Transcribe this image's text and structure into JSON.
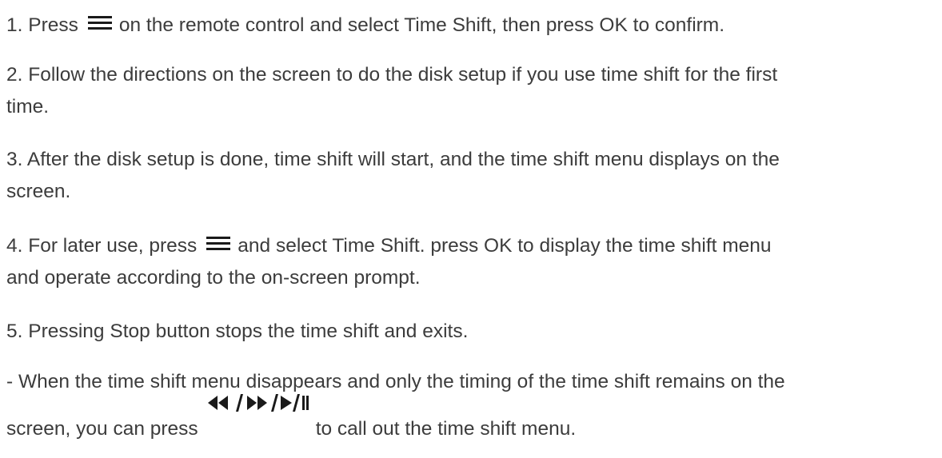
{
  "steps": [
    {
      "line1": "1. Press",
      "line1_after_icon": "on the remote control and select Time Shift, then press OK to confirm."
    },
    {
      "line1": "2. Follow the directions on the screen to do the disk setup if you use time shift for the first",
      "line2": "time."
    },
    {
      "line1": "3. After the disk setup is done, time shift will start, and the time shift menu displays on the",
      "line2": "screen."
    },
    {
      "line1": "4. For later use, press",
      "line1_after_icon": "and select Time Shift. press OK to display the time shift menu",
      "line2": "and operate according to the on-screen prompt."
    },
    {
      "line1": "5. Pressing Stop button stops the time shift and exits."
    }
  ],
  "note": {
    "line1": "- When the time shift menu disappears and only the timing of the time shift remains on the",
    "line2_before_icon": "screen, you can press",
    "line2_after_icon": "to call out the time shift menu."
  },
  "icons": {
    "menu": "menu-icon",
    "transport": "rewind-forward-play-pause-icon"
  },
  "colors": {
    "text": "#3c3c3c",
    "icon": "#1a1a1a"
  }
}
